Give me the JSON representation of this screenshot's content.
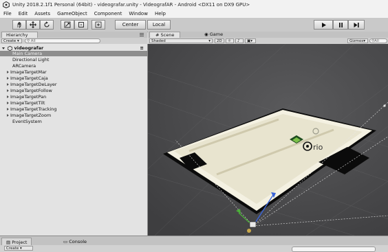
{
  "window": {
    "title": "Unity 2018.2.1f1 Personal (64bit) - videografar.unity - VideografAR - Android <DX11 on DX9 GPU>"
  },
  "menu": [
    "File",
    "Edit",
    "Assets",
    "GameObject",
    "Component",
    "Window",
    "Help"
  ],
  "toolbar": {
    "tools": [
      "hand-tool-icon",
      "move-tool-icon",
      "rotate-tool-icon",
      "scale-tool-icon",
      "rect-tool-icon",
      "transform-tool-icon"
    ],
    "pivot_label": "Center",
    "space_label": "Local",
    "play_icon": "play-icon",
    "pause_icon": "pause-icon",
    "step_icon": "step-icon"
  },
  "hierarchy": {
    "tab_label": "Hierarchy",
    "create_label": "Create",
    "search_placeholder": "All",
    "scene_name": "videografar",
    "items": [
      {
        "label": "Main Camera",
        "expandable": false,
        "selected": true
      },
      {
        "label": "Directional Light",
        "expandable": false,
        "selected": false
      },
      {
        "label": "ARCamera",
        "expandable": false,
        "selected": false
      },
      {
        "label": "ImageTargetMar",
        "expandable": true,
        "selected": false
      },
      {
        "label": "ImageTargetCaja",
        "expandable": true,
        "selected": false
      },
      {
        "label": "ImageTargetDeLayer",
        "expandable": true,
        "selected": false
      },
      {
        "label": "ImageTargetFollow",
        "expandable": true,
        "selected": false
      },
      {
        "label": "ImageTargetPan",
        "expandable": true,
        "selected": false
      },
      {
        "label": "ImageTargetTilt",
        "expandable": true,
        "selected": false
      },
      {
        "label": "ImageTargetTracking",
        "expandable": true,
        "selected": false
      },
      {
        "label": "ImageTargetZoom",
        "expandable": true,
        "selected": false
      },
      {
        "label": "EventSystem",
        "expandable": false,
        "selected": false
      }
    ]
  },
  "scene": {
    "tabs": [
      "Scene",
      "Game"
    ],
    "shading_mode": "Shaded",
    "mode_2d": "2D",
    "gizmos_label": "Gizmos",
    "search_placeholder": "All",
    "target_text": "rio"
  },
  "bottom": {
    "tabs": [
      "Project",
      "Console"
    ],
    "create_label": "Create"
  },
  "colors": {
    "selection": "#8d8d8d",
    "scene_bg": "#4a4a4c",
    "target_card": "#e8e4cf"
  }
}
